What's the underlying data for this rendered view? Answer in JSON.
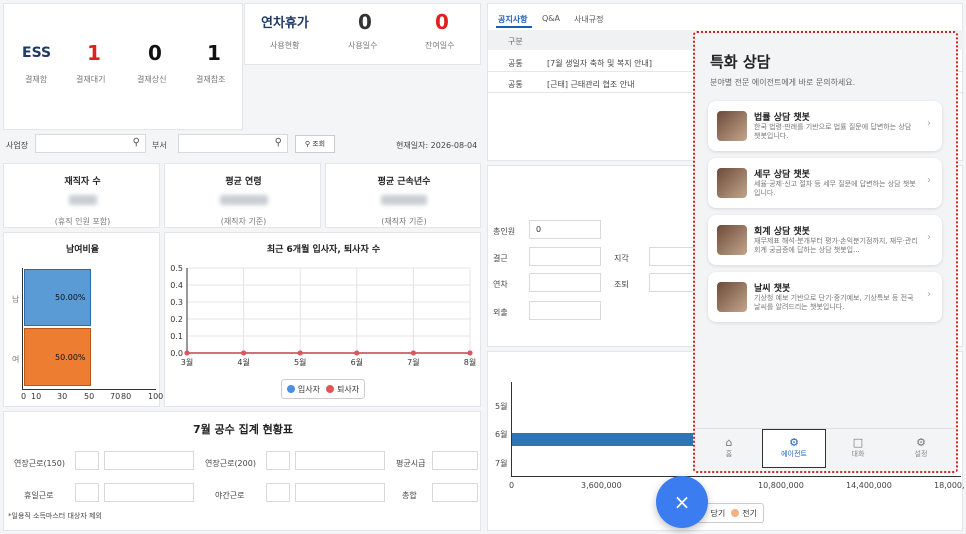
{
  "ess": {
    "title": "ESS",
    "items": [
      {
        "value": "1",
        "label": "결재대기",
        "color": "#e02020"
      },
      {
        "value": "0",
        "label": "결재상신",
        "color": "#111"
      },
      {
        "value": "1",
        "label": "결재참조",
        "color": "#111"
      }
    ],
    "label_main": "결재함"
  },
  "leave": {
    "title": "연차휴가",
    "sub": "사용현황",
    "used": "0",
    "used_label": "사용일수",
    "remain": "0",
    "remain_label": "잔여일수",
    "remain_color": "#e02020"
  },
  "filter": {
    "site_label": "사업장",
    "dept_label": "부서",
    "search_btn": "조회",
    "date": "현재일자: 2026-08-04"
  },
  "stats": [
    {
      "title": "재직자 수",
      "note": "(휴직 인원 포함)"
    },
    {
      "title": "평균 연령",
      "note": "(재직자 기준)"
    },
    {
      "title": "평균 근속년수",
      "note": "(재직자 기준)"
    }
  ],
  "gender": {
    "title": "남여비율",
    "rows": [
      {
        "label": "남",
        "value": "50.00%",
        "color": "#5b9bd5"
      },
      {
        "label": "여",
        "value": "50.00%",
        "color": "#ed7d31"
      }
    ],
    "ticks": [
      "0",
      "10",
      "30",
      "50",
      "70",
      "80",
      "100"
    ]
  },
  "chart_data": {
    "type": "line",
    "title": "최근 6개월 입사자, 퇴사자 수",
    "categories": [
      "3월",
      "4월",
      "5월",
      "6월",
      "7월",
      "8월"
    ],
    "series": [
      {
        "name": "입사자",
        "values": [
          0,
          0,
          0,
          0,
          0,
          0
        ],
        "color": "#4a90e2"
      },
      {
        "name": "퇴사자",
        "values": [
          0,
          0,
          0,
          0,
          0,
          0
        ],
        "color": "#e05555"
      }
    ],
    "ylim": [
      0,
      0.5
    ],
    "yticks": [
      "0.5",
      "0.4",
      "0.3",
      "0.2",
      "0.1",
      "0.0"
    ]
  },
  "hours": {
    "title": "7월 공수 집계 현황표",
    "labels": [
      "연장근로(150)",
      "연장근로(200)",
      "평균시급",
      "휴일근로",
      "야간근로",
      "총합"
    ],
    "note": "*일용직 소득마스터 대상자 제외"
  },
  "notice": {
    "tabs": [
      "공지사항",
      "Q&A",
      "사내규정"
    ],
    "col": "구분",
    "rows": [
      {
        "type": "공통",
        "text": "[7월 생일자 축하 및 복지 안내]"
      },
      {
        "type": "공통",
        "text": "[근태] 근태관리 협조 안내"
      }
    ]
  },
  "attendance": {
    "labels": [
      "총인원",
      "결근",
      "지각",
      "연차",
      "조퇴",
      "외출"
    ],
    "total": "0"
  },
  "bar": {
    "cats": [
      "5월",
      "6월",
      "7월"
    ],
    "xticks": [
      "0",
      "3,600,000",
      "",
      "10,800,000",
      "14,400,000",
      "18,000,"
    ],
    "legend_cut": "당기",
    "legend_prev": "전기"
  },
  "panel": {
    "title": "특화 상담",
    "subtitle": "분야별 전문 에이전트에게 바로 문의하세요.",
    "bots": [
      {
        "name": "법률 상담 챗봇",
        "desc": "한국 법령·판례를 기반으로 법률 질문에 답변하는 상담 챗봇입니다."
      },
      {
        "name": "세무 상담 챗봇",
        "desc": "세율·공제·신고 절차 등 세무 질문에 답변하는 상담 챗봇입니다."
      },
      {
        "name": "회계 상담 챗봇",
        "desc": "재무제표 해석·분개부터 평가·손익분기점까지, 재무·관리회계 궁금증에 답하는 상담 챗봇입..."
      },
      {
        "name": "날씨 챗봇",
        "desc": "기상청 예보 기반으로 단기·중기예보, 기상특보 등 전국 날씨를 알려드리는 챗봇입니다."
      }
    ],
    "nav": [
      "홈",
      "에이전트",
      "대화",
      "설정"
    ]
  },
  "fab": "×"
}
